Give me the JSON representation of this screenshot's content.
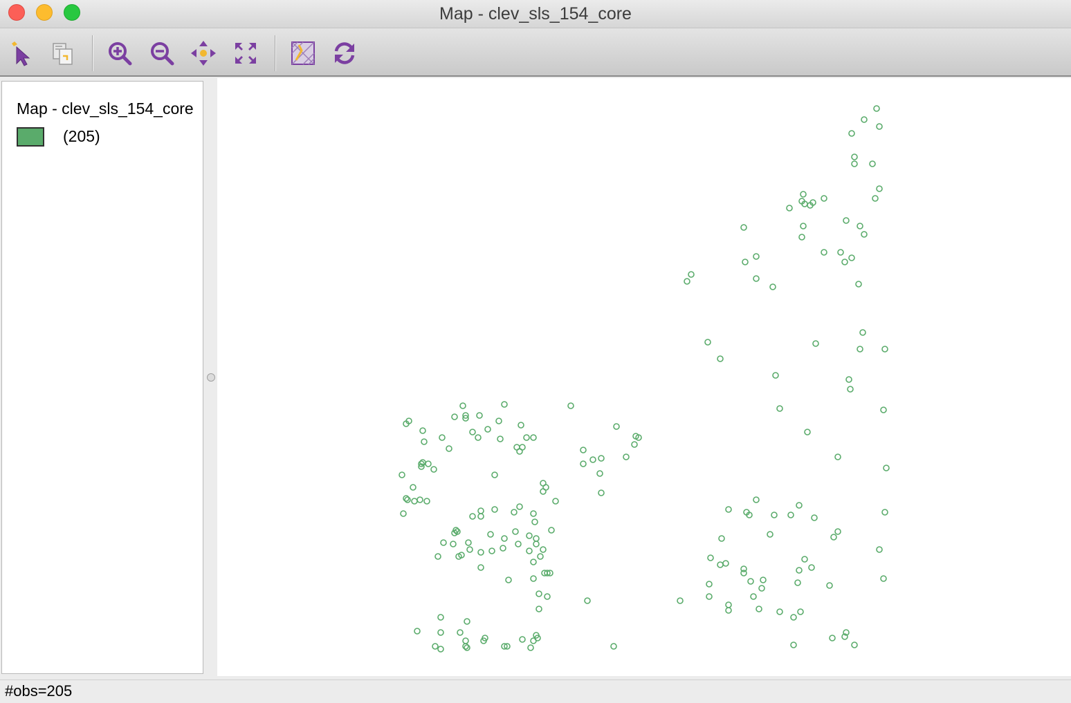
{
  "window": {
    "title": "Map - clev_sls_154_core"
  },
  "toolbar": {
    "tools": [
      {
        "name": "select-tool",
        "icon": "select-arrow-icon"
      },
      {
        "name": "selection-shape-tool",
        "icon": "selection-shape-icon"
      },
      {
        "name": "zoom-in-tool",
        "icon": "zoom-in-icon"
      },
      {
        "name": "zoom-out-tool",
        "icon": "zoom-out-icon"
      },
      {
        "name": "pan-tool",
        "icon": "pan-icon"
      },
      {
        "name": "full-extent-tool",
        "icon": "full-extent-icon"
      },
      {
        "name": "basemap-tool",
        "icon": "basemap-icon"
      },
      {
        "name": "refresh-tool",
        "icon": "refresh-icon"
      }
    ],
    "icon_color": "#7b3fa1",
    "accent_color": "#f2b830"
  },
  "legend": {
    "title": "Map - clev_sls_154_core",
    "swatch_color": "#5aab6b",
    "count_label": "(205)"
  },
  "map": {
    "point_color": "#5aab6b",
    "points": [
      [
        1267,
        157
      ],
      [
        1249,
        173
      ],
      [
        1271,
        183
      ],
      [
        1231,
        193
      ],
      [
        1235,
        227
      ],
      [
        1235,
        237
      ],
      [
        1261,
        237
      ],
      [
        1271,
        273
      ],
      [
        1265,
        287
      ],
      [
        1161,
        281
      ],
      [
        1159,
        291
      ],
      [
        1163,
        295
      ],
      [
        1175,
        293
      ],
      [
        1171,
        297
      ],
      [
        1191,
        287
      ],
      [
        1141,
        301
      ],
      [
        1223,
        319
      ],
      [
        1075,
        329
      ],
      [
        1161,
        327
      ],
      [
        1243,
        327
      ],
      [
        1159,
        343
      ],
      [
        1249,
        339
      ],
      [
        1191,
        365
      ],
      [
        1215,
        365
      ],
      [
        1093,
        371
      ],
      [
        1077,
        379
      ],
      [
        1231,
        373
      ],
      [
        1221,
        379
      ],
      [
        999,
        397
      ],
      [
        993,
        407
      ],
      [
        1093,
        403
      ],
      [
        1117,
        415
      ],
      [
        1241,
        411
      ],
      [
        1023,
        495
      ],
      [
        1179,
        497
      ],
      [
        1247,
        481
      ],
      [
        1041,
        519
      ],
      [
        1243,
        505
      ],
      [
        1279,
        505
      ],
      [
        1121,
        543
      ],
      [
        1227,
        549
      ],
      [
        1229,
        563
      ],
      [
        1127,
        591
      ],
      [
        1277,
        593
      ],
      [
        1167,
        625
      ],
      [
        1211,
        661
      ],
      [
        1281,
        677
      ],
      [
        1093,
        723
      ],
      [
        1053,
        737
      ],
      [
        1079,
        741
      ],
      [
        1083,
        745
      ],
      [
        1119,
        745
      ],
      [
        1155,
        731
      ],
      [
        1143,
        745
      ],
      [
        1177,
        749
      ],
      [
        1279,
        741
      ],
      [
        1043,
        779
      ],
      [
        1113,
        773
      ],
      [
        1211,
        769
      ],
      [
        1205,
        777
      ],
      [
        1027,
        807
      ],
      [
        1041,
        817
      ],
      [
        1049,
        815
      ],
      [
        1075,
        823
      ],
      [
        1075,
        829
      ],
      [
        1163,
        809
      ],
      [
        1155,
        825
      ],
      [
        1173,
        821
      ],
      [
        1271,
        795
      ],
      [
        1025,
        845
      ],
      [
        1085,
        841
      ],
      [
        1103,
        839
      ],
      [
        1101,
        851
      ],
      [
        1153,
        843
      ],
      [
        1199,
        847
      ],
      [
        1277,
        837
      ],
      [
        1025,
        863
      ],
      [
        1089,
        863
      ],
      [
        983,
        869
      ],
      [
        1053,
        875
      ],
      [
        1053,
        883
      ],
      [
        1097,
        881
      ],
      [
        1127,
        885
      ],
      [
        1147,
        893
      ],
      [
        1157,
        885
      ],
      [
        1223,
        915
      ],
      [
        1221,
        921
      ],
      [
        1203,
        923
      ],
      [
        1235,
        933
      ],
      [
        1147,
        933
      ],
      [
        669,
        587
      ],
      [
        729,
        585
      ],
      [
        657,
        603
      ],
      [
        673,
        601
      ],
      [
        673,
        605
      ],
      [
        693,
        601
      ],
      [
        591,
        609
      ],
      [
        587,
        613
      ],
      [
        721,
        609
      ],
      [
        753,
        615
      ],
      [
        611,
        623
      ],
      [
        683,
        625
      ],
      [
        705,
        621
      ],
      [
        639,
        633
      ],
      [
        613,
        639
      ],
      [
        691,
        633
      ],
      [
        723,
        635
      ],
      [
        761,
        633
      ],
      [
        771,
        633
      ],
      [
        649,
        649
      ],
      [
        747,
        647
      ],
      [
        755,
        647
      ],
      [
        751,
        653
      ],
      [
        825,
        587
      ],
      [
        891,
        617
      ],
      [
        919,
        631
      ],
      [
        923,
        633
      ],
      [
        917,
        643
      ],
      [
        905,
        661
      ],
      [
        843,
        651
      ],
      [
        857,
        665
      ],
      [
        869,
        663
      ],
      [
        843,
        671
      ],
      [
        867,
        685
      ],
      [
        869,
        713
      ],
      [
        609,
        671
      ],
      [
        611,
        669
      ],
      [
        619,
        671
      ],
      [
        609,
        675
      ],
      [
        627,
        679
      ],
      [
        581,
        687
      ],
      [
        715,
        687
      ],
      [
        597,
        705
      ],
      [
        785,
        699
      ],
      [
        789,
        705
      ],
      [
        785,
        711
      ],
      [
        587,
        721
      ],
      [
        589,
        723
      ],
      [
        599,
        725
      ],
      [
        607,
        723
      ],
      [
        617,
        725
      ],
      [
        803,
        725
      ],
      [
        751,
        733
      ],
      [
        583,
        743
      ],
      [
        695,
        739
      ],
      [
        715,
        737
      ],
      [
        743,
        741
      ],
      [
        683,
        747
      ],
      [
        695,
        747
      ],
      [
        771,
        743
      ],
      [
        773,
        755
      ],
      [
        659,
        767
      ],
      [
        657,
        771
      ],
      [
        661,
        769
      ],
      [
        709,
        773
      ],
      [
        745,
        769
      ],
      [
        765,
        775
      ],
      [
        797,
        767
      ],
      [
        775,
        779
      ],
      [
        677,
        785
      ],
      [
        641,
        785
      ],
      [
        655,
        787
      ],
      [
        729,
        779
      ],
      [
        775,
        787
      ],
      [
        749,
        787
      ],
      [
        679,
        795
      ],
      [
        695,
        799
      ],
      [
        711,
        797
      ],
      [
        727,
        793
      ],
      [
        785,
        795
      ],
      [
        765,
        797
      ],
      [
        781,
        805
      ],
      [
        663,
        805
      ],
      [
        667,
        803
      ],
      [
        633,
        805
      ],
      [
        771,
        813
      ],
      [
        695,
        821
      ],
      [
        787,
        829
      ],
      [
        791,
        829
      ],
      [
        795,
        829
      ],
      [
        735,
        839
      ],
      [
        771,
        837
      ],
      [
        779,
        859
      ],
      [
        791,
        863
      ],
      [
        849,
        869
      ],
      [
        779,
        881
      ],
      [
        637,
        893
      ],
      [
        675,
        899
      ],
      [
        603,
        913
      ],
      [
        637,
        915
      ],
      [
        665,
        915
      ],
      [
        775,
        919
      ],
      [
        701,
        923
      ],
      [
        699,
        927
      ],
      [
        673,
        927
      ],
      [
        777,
        923
      ],
      [
        755,
        925
      ],
      [
        771,
        927
      ],
      [
        629,
        935
      ],
      [
        637,
        939
      ],
      [
        673,
        935
      ],
      [
        675,
        937
      ],
      [
        729,
        935
      ],
      [
        733,
        935
      ],
      [
        767,
        937
      ],
      [
        887,
        935
      ]
    ]
  },
  "status_bar": {
    "text": "#obs=205"
  }
}
